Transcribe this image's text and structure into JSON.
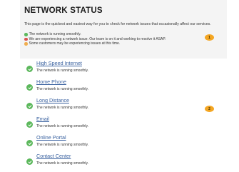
{
  "header": {
    "title": "NETWORK STATUS",
    "intro": "This page is the quickest and easiest way for you to check for network issues that occasionally affect our services."
  },
  "legend": [
    {
      "color": "#5cb85c",
      "text": "The network is running smoothly."
    },
    {
      "color": "#d9534f",
      "text": "We are experiencing a network issue. Our team is on it and working to resolve it ASAP."
    },
    {
      "color": "#f0ad4e",
      "text": "Some customers may be experiencing issues at this time."
    }
  ],
  "callouts": [
    "1",
    "2"
  ],
  "services": [
    {
      "name": "High Speed Internet",
      "status": "The network is running smoothly."
    },
    {
      "name": "Home Phone",
      "status": "The network is running smoothly."
    },
    {
      "name": "Long Distance",
      "status": "The network is running smoothly."
    },
    {
      "name": "Email",
      "status": "The network is running smoothly."
    },
    {
      "name": "Online Portal",
      "status": "The network is running smoothly."
    },
    {
      "name": "Contact Center",
      "status": "The network is running smoothly."
    }
  ]
}
